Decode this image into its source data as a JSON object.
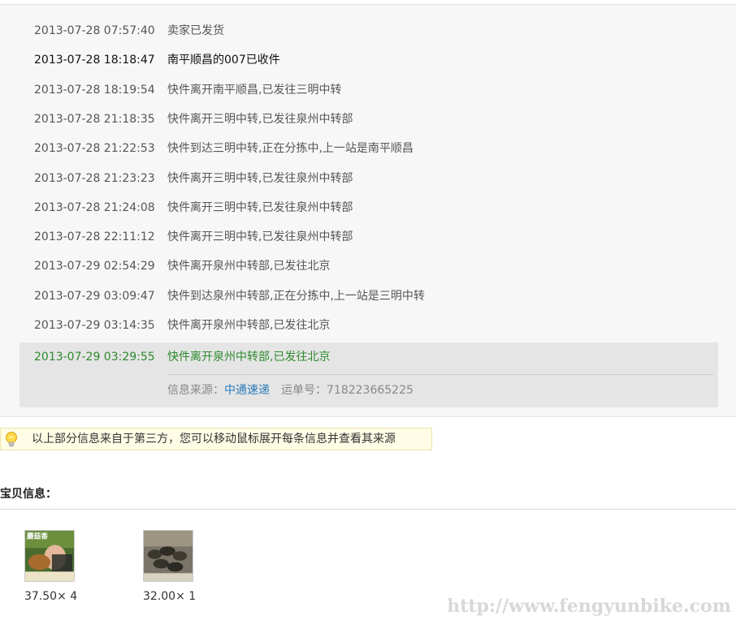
{
  "tracking": {
    "events": [
      {
        "time": "2013-07-28 07:57:40",
        "desc": "卖家已发货"
      },
      {
        "time": "2013-07-28 18:18:47",
        "desc": "南平顺昌的007已收件"
      },
      {
        "time": "2013-07-28 18:19:54",
        "desc": "快件离开南平顺昌,已发往三明中转"
      },
      {
        "time": "2013-07-28 21:18:35",
        "desc": "快件离开三明中转,已发往泉州中转部"
      },
      {
        "time": "2013-07-28 21:22:53",
        "desc": "快件到达三明中转,正在分拣中,上一站是南平顺昌"
      },
      {
        "time": "2013-07-28 21:23:23",
        "desc": "快件离开三明中转,已发往泉州中转部"
      },
      {
        "time": "2013-07-28 21:24:08",
        "desc": "快件离开三明中转,已发往泉州中转部"
      },
      {
        "time": "2013-07-28 22:11:12",
        "desc": "快件离开三明中转,已发往泉州中转部"
      },
      {
        "time": "2013-07-29 02:54:29",
        "desc": "快件离开泉州中转部,已发往北京"
      },
      {
        "time": "2013-07-29 03:09:47",
        "desc": "快件到达泉州中转部,正在分拣中,上一站是三明中转"
      },
      {
        "time": "2013-07-29 03:14:35",
        "desc": "快件离开泉州中转部,已发往北京"
      }
    ],
    "latest": {
      "time": "2013-07-29 03:29:55",
      "desc": "快件离开泉州中转部,已发往北京"
    },
    "source_label": "信息来源：",
    "carrier": "中通速递",
    "waybill_label": "运单号：",
    "waybill_number": "718223665225"
  },
  "tip": {
    "icon": "lightbulb-icon",
    "text": "以上部分信息来自于第三方，您可以移动鼠标展开每条信息并查看其来源"
  },
  "items_section": {
    "title": "宝贝信息：",
    "items": [
      {
        "price": "37.50× 4",
        "image_text": "蘑菇香"
      },
      {
        "price": "32.00× 1"
      }
    ]
  },
  "watermark": "http://www.fengyunbike.com",
  "colors": {
    "latest_event": "#2d8a2d",
    "carrier_link": "#2b7bb9",
    "tip_background": "#fffde6"
  }
}
